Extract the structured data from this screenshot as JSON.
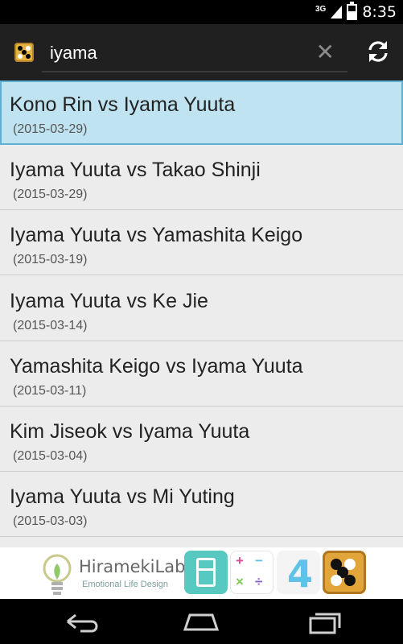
{
  "status_bar": {
    "network": "3G",
    "time": "8:35"
  },
  "search": {
    "query": "iyama",
    "placeholder": "",
    "app_icon": "go-board-app-icon",
    "clear_icon": "close-icon",
    "refresh_icon": "refresh-icon"
  },
  "games": [
    {
      "title": "Kono Rin vs Iyama Yuuta",
      "date": "(2015-03-29)",
      "selected": true
    },
    {
      "title": "Iyama Yuuta vs Takao Shinji",
      "date": "(2015-03-29)"
    },
    {
      "title": "Iyama Yuuta vs Yamashita Keigo",
      "date": "(2015-03-19)"
    },
    {
      "title": "Iyama Yuuta vs Ke Jie",
      "date": "(2015-03-14)"
    },
    {
      "title": "Yamashita Keigo vs Iyama Yuuta",
      "date": "(2015-03-11)"
    },
    {
      "title": "Kim Jiseok vs Iyama Yuuta",
      "date": "(2015-03-04)"
    },
    {
      "title": "Iyama Yuuta vs Mi Yuting",
      "date": "(2015-03-03)"
    }
  ],
  "ad": {
    "brand": "HiramekiLab",
    "tagline": "Emotional Life Design",
    "apps": [
      "fridge-app-icon",
      "math-app-icon",
      "four-app-icon",
      "go-board-app-icon"
    ],
    "four_label": "4",
    "math_symbols": [
      "+",
      "−",
      "×",
      "÷"
    ]
  },
  "nav": {
    "back": "back-icon",
    "home": "home-icon",
    "recents": "recents-icon"
  },
  "colors": {
    "action_bar": "#202020",
    "selected_bg": "#bfe3f0",
    "selected_border": "#5fb0d3",
    "list_bg": "#ececec"
  }
}
